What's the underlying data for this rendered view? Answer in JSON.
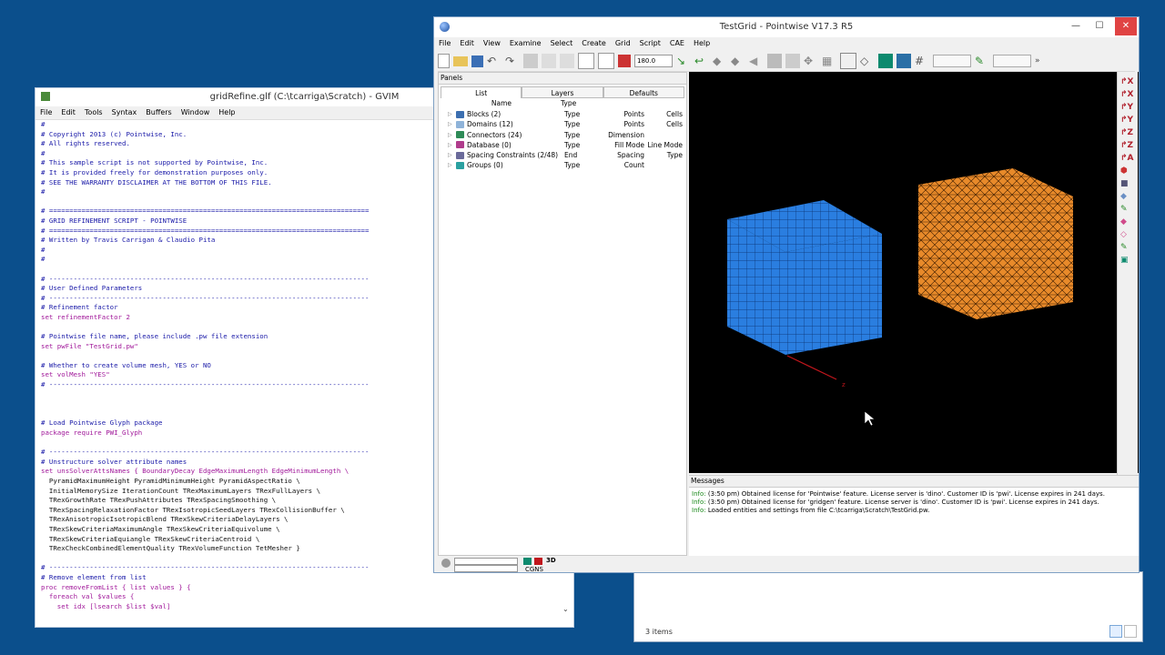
{
  "explorer": {
    "status": "3 items"
  },
  "gvim": {
    "title": "gridRefine.glf (C:\\tcarriga\\Scratch) - GVIM",
    "menus": [
      "File",
      "Edit",
      "Tools",
      "Syntax",
      "Buffers",
      "Window",
      "Help"
    ],
    "lines": [
      {
        "t": "#",
        "c": "cm"
      },
      {
        "t": "# Copyright 2013 (c) Pointwise, Inc.",
        "c": "cm"
      },
      {
        "t": "# All rights reserved.",
        "c": "cm"
      },
      {
        "t": "#",
        "c": "cm"
      },
      {
        "t": "# This sample script is not supported by Pointwise, Inc.",
        "c": "cm"
      },
      {
        "t": "# It is provided freely for demonstration purposes only.",
        "c": "cm"
      },
      {
        "t": "# SEE THE WARRANTY DISCLAIMER AT THE BOTTOM OF THIS FILE.",
        "c": "cm"
      },
      {
        "t": "#",
        "c": "cm"
      },
      {
        "t": "",
        "c": "cm"
      },
      {
        "t": "# ===============================================================================",
        "c": "cm"
      },
      {
        "t": "# GRID REFINEMENT SCRIPT - POINTWISE",
        "c": "cm"
      },
      {
        "t": "# ===============================================================================",
        "c": "cm"
      },
      {
        "t": "# Written by Travis Carrigan & Claudio Pita",
        "c": "cm"
      },
      {
        "t": "#",
        "c": "cm"
      },
      {
        "t": "#",
        "c": "cm"
      },
      {
        "t": "",
        "c": "cm"
      },
      {
        "t": "# -------------------------------------------------------------------------------",
        "c": "cm"
      },
      {
        "t": "# User Defined Parameters",
        "c": "cm"
      },
      {
        "t": "# -------------------------------------------------------------------------------",
        "c": "cm"
      },
      {
        "t": "# Refinement factor",
        "c": "cm"
      },
      {
        "t": "set refinementFactor 2",
        "c": "set"
      },
      {
        "t": "",
        "c": "cm"
      },
      {
        "t": "# Pointwise file name, please include .pw file extension",
        "c": "cm"
      },
      {
        "t": "set pwFile \"TestGrid.pw\"",
        "c": "set"
      },
      {
        "t": "",
        "c": "cm"
      },
      {
        "t": "# Whether to create volume mesh, YES or NO",
        "c": "cm"
      },
      {
        "t": "set volMesh \"YES\"",
        "c": "set"
      },
      {
        "t": "# -------------------------------------------------------------------------------",
        "c": "cm"
      },
      {
        "t": "",
        "c": "cm"
      },
      {
        "t": "",
        "c": "cm"
      },
      {
        "t": "",
        "c": "cm"
      },
      {
        "t": "# Load Pointwise Glyph package",
        "c": "cm"
      },
      {
        "t": "package require PWI_Glyph",
        "c": "set"
      },
      {
        "t": "",
        "c": "cm"
      },
      {
        "t": "# -------------------------------------------------------------------------------",
        "c": "cm"
      },
      {
        "t": "# Unstructure solver attribute names",
        "c": "cm"
      },
      {
        "t": "set unsSolverAttsNames { BoundaryDecay EdgeMaximumLength EdgeMinimumLength \\",
        "c": "set"
      },
      {
        "t": "  PyramidMaximumHeight PyramidMinimumHeight PyramidAspectRatio \\",
        "c": "plain"
      },
      {
        "t": "  InitialMemorySize IterationCount TRexMaximumLayers TRexFullLayers \\",
        "c": "plain"
      },
      {
        "t": "  TRexGrowthRate TRexPushAttributes TRexSpacingSmoothing \\",
        "c": "plain"
      },
      {
        "t": "  TRexSpacingRelaxationFactor TRexIsotropicSeedLayers TRexCollisionBuffer \\",
        "c": "plain"
      },
      {
        "t": "  TRexAnisotropicIsotropicBlend TRexSkewCriteriaDelayLayers \\",
        "c": "plain"
      },
      {
        "t": "  TRexSkewCriteriaMaximumAngle TRexSkewCriteriaEquivolume \\",
        "c": "plain"
      },
      {
        "t": "  TRexSkewCriteriaEquiangle TRexSkewCriteriaCentroid \\",
        "c": "plain"
      },
      {
        "t": "  TRexCheckCombinedElementQuality TRexVolumeFunction TetMesher }",
        "c": "plain"
      },
      {
        "t": "",
        "c": "cm"
      },
      {
        "t": "# -------------------------------------------------------------------------------",
        "c": "cm"
      },
      {
        "t": "# Remove element from list",
        "c": "cm"
      },
      {
        "t": "proc removeFromList { list values } {",
        "c": "set"
      },
      {
        "t": "  foreach val $values {",
        "c": "set"
      },
      {
        "t": "    set idx [lsearch $list $val]",
        "c": "set"
      }
    ]
  },
  "pointwise": {
    "title": "TestGrid - Pointwise V17.3 R5",
    "window_controls": [
      "—",
      "☐",
      "✕"
    ],
    "menus": [
      "File",
      "Edit",
      "View",
      "Examine",
      "Select",
      "Create",
      "Grid",
      "Script",
      "CAE",
      "Help"
    ],
    "angle_value": "180.0",
    "panels": {
      "header": "Panels",
      "tabs": [
        "List",
        "Layers",
        "Defaults"
      ],
      "columns": [
        "Name",
        "Type"
      ],
      "rows": [
        {
          "name": "Blocks (2)",
          "c1": "Type",
          "c2": "Points",
          "c3": "Cells",
          "color": "#3c6fb0"
        },
        {
          "name": "Domains (12)",
          "c1": "Type",
          "c2": "Points",
          "c3": "Cells",
          "color": "#8fb3d9"
        },
        {
          "name": "Connectors (24)",
          "c1": "Type",
          "c2": "Dimension",
          "c3": "",
          "color": "#2e8b57"
        },
        {
          "name": "Database (0)",
          "c1": "Type",
          "c2": "Fill Mode",
          "c3": "Line Mode",
          "color": "#b03c8c"
        },
        {
          "name": "Spacing Constraints (2/48)",
          "c1": "End",
          "c2": "Spacing",
          "c3": "Type",
          "color": "#6a6a9a"
        },
        {
          "name": "Groups (0)",
          "c1": "Type",
          "c2": "Count",
          "c3": "",
          "color": "#2aa0a0"
        }
      ]
    },
    "viewport": {
      "axis_label": "z"
    },
    "messages": {
      "header": "Messages",
      "lines": [
        {
          "tag": "Info:",
          "text": " (3:50 pm) Obtained license for 'Pointwise' feature. License server is 'dino'. Customer ID is 'pwi'. License expires in 241 days."
        },
        {
          "tag": "Info:",
          "text": " (3:50 pm) Obtained license for 'gridgen' feature. License server is 'dino'. Customer ID is 'pwi'. License expires in 241 days."
        },
        {
          "tag": "Info:",
          "text": " Loaded entities and settings from file C:\\tcarriga\\Scratch\\TestGrid.pw."
        }
      ]
    },
    "status": {
      "solver": "CGNS",
      "mode": "3D"
    }
  }
}
